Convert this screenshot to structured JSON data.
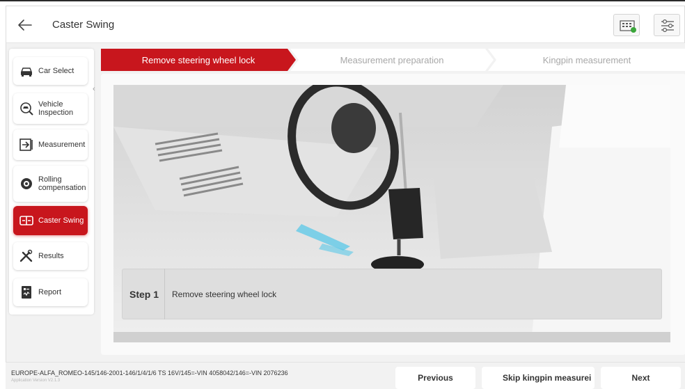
{
  "header": {
    "title": "Caster Swing",
    "back_icon": "arrow-left-icon",
    "vci_icon": "vci-connector-icon",
    "settings_icon": "sliders-settings-icon"
  },
  "sidebar": {
    "items": [
      {
        "label": "Car Select",
        "icon": "car-icon",
        "active": false
      },
      {
        "label": "Vehicle Inspection",
        "icon": "inspection-car-icon",
        "active": false
      },
      {
        "label": "Measurement",
        "icon": "measurement-icon",
        "active": false
      },
      {
        "label": "Rolling compensation",
        "icon": "wheel-gear-icon",
        "active": false
      },
      {
        "label": "Caster Swing",
        "icon": "caster-swing-icon",
        "active": true
      },
      {
        "label": "Results",
        "icon": "results-tools-icon",
        "active": false
      },
      {
        "label": "Report",
        "icon": "report-icon",
        "active": false
      }
    ]
  },
  "steps": [
    {
      "label": "Remove steering wheel lock",
      "active": true
    },
    {
      "label": "Measurement preparation",
      "active": false
    },
    {
      "label": "Kingpin measurement",
      "active": false
    }
  ],
  "instruction": {
    "step_label": "Step 1",
    "text": "Remove steering wheel lock"
  },
  "footer": {
    "vehicle_info": "EUROPE-ALFA_ROMEO-145/146-2001-146/1/4/1/6 TS 16V/145=-VIN 4058042/146=-VIN 2076236",
    "version": "Application Version V2.1.3",
    "previous_label": "Previous",
    "skip_label": "Skip kingpin measurei",
    "next_label": "Next"
  },
  "colors": {
    "accent": "#c8161d",
    "background": "#f2f2f2",
    "inactive_text": "#a8a8a8"
  }
}
